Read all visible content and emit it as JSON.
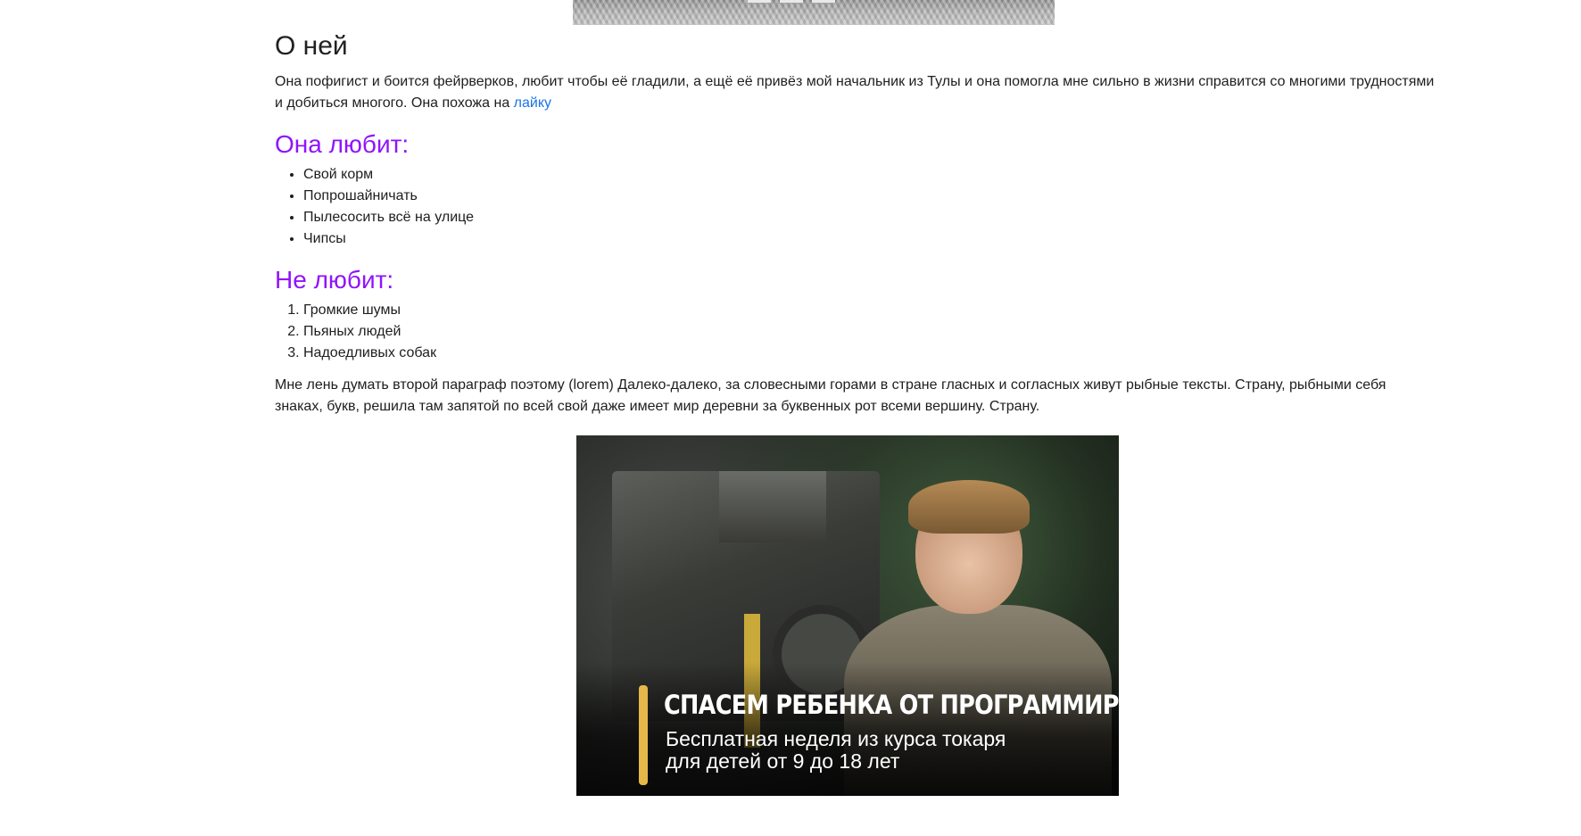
{
  "top_image": {
    "alt": ""
  },
  "about": {
    "title": "О ней",
    "paragraph_before_link": "Она пофигист и боится фейрверков, любит чтобы её гладили, а ещё её привёз мой начальник из Тулы и она помогла мне сильно в жизни справится со многими трудностями и добиться многого. Она похожа на ",
    "link_text": "лайку"
  },
  "likes": {
    "title": "Она любит:",
    "items": [
      "Свой корм",
      "Попрошайничать",
      "Пылесосить всё на улице",
      "Чипсы"
    ]
  },
  "dislikes": {
    "title": "Не любит:",
    "items": [
      "Громкие шумы",
      "Пьяных людей",
      "Надоедливых собак"
    ]
  },
  "second_paragraph": "Мне лень думать второй параграф поэтому (lorem) Далеко-далеко, за словесными горами в стране гласных и согласных живут рыбные тексты. Страну, рыбными себя знаках, букв, решила там запятой по всей свой даже имеет мир деревни за буквенных рот всеми вершину. Страну.",
  "promo": {
    "headline": "СПАСЕМ РЕБЕНКА ОТ ПРОГРАММИРОВАНИЯ",
    "tagline_line1": "Бесплатная неделя из курса токаря",
    "tagline_line2": "для детей от 9 до 18 лет"
  },
  "colors": {
    "heading_accent": "#9013fe",
    "link": "#1a73e8",
    "promo_accent": "#e6b84a"
  }
}
